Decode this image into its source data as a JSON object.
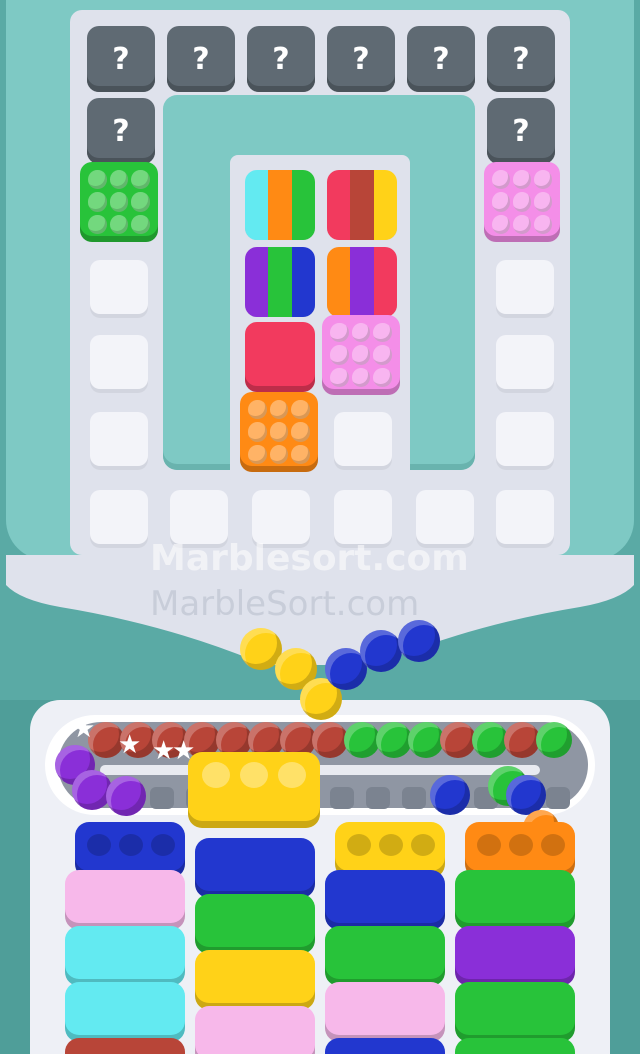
{
  "mystery_label": "?",
  "watermark_main": "Marblesort.com",
  "watermark_sub": "MarbleSort.com",
  "colors": {
    "red": "#b84538",
    "green": "#28c33a",
    "blue": "#2237cf",
    "yellow": "#ffd218",
    "purple": "#8a2fd8",
    "orange": "#ff8a14",
    "pink": "#f48ee8",
    "cyan": "#63eaf1",
    "crimson": "#f23a5e",
    "lightpink": "#f7b8ea",
    "mystery": "#5f6a73"
  },
  "board": {
    "mystery_tiles": 8,
    "tiles": [
      {
        "name": "green-dotted-tile",
        "pattern": "dots",
        "color": "green"
      },
      {
        "name": "pink-dotted-tile-right",
        "pattern": "dots",
        "color": "pink"
      },
      {
        "name": "striped-tile-cyan-orange-green",
        "pattern": "stripes",
        "stripes": [
          "#63eaf1",
          "#ff8a14",
          "#28c33a"
        ]
      },
      {
        "name": "striped-tile-red-brown-yellow",
        "pattern": "stripes",
        "stripes": [
          "#f23a5e",
          "#b84538",
          "#ffd218"
        ]
      },
      {
        "name": "striped-tile-purple-green-blue",
        "pattern": "stripes",
        "stripes": [
          "#8a2fd8",
          "#28c33a",
          "#2237cf"
        ]
      },
      {
        "name": "striped-tile-orange-purple-red",
        "pattern": "stripes",
        "stripes": [
          "#ff8a14",
          "#8a2fd8",
          "#f23a5e"
        ]
      },
      {
        "name": "crimson-plain-tile",
        "pattern": "plain",
        "color": "crimson"
      },
      {
        "name": "pink-dotted-tile-center",
        "pattern": "dots",
        "color": "pink"
      },
      {
        "name": "orange-dotted-tile",
        "pattern": "dots",
        "color": "orange"
      }
    ]
  },
  "conveyor": {
    "top_marbles": [
      "red",
      "red",
      "red",
      "red",
      "red",
      "red",
      "red",
      "red",
      "green",
      "green",
      "green",
      "red",
      "green",
      "red",
      "green"
    ],
    "left_marbles": [
      "purple",
      "purple",
      "purple"
    ],
    "right_marbles": [
      "blue",
      "green",
      "blue"
    ],
    "stars": 4
  },
  "falling_marbles": [
    "yellow",
    "yellow",
    "yellow",
    "blue",
    "blue",
    "blue"
  ],
  "active_cup": {
    "color": "yellow",
    "holes": 3
  },
  "cup_columns": [
    {
      "top": {
        "color": "blue",
        "holes": 3
      },
      "stack": [
        "lightpink",
        "cyan",
        "cyan",
        "red"
      ]
    },
    {
      "stack": [
        "blue",
        "green",
        "yellow",
        "lightpink"
      ]
    },
    {
      "top": {
        "color": "yellow",
        "holes": 3
      },
      "stack": [
        "blue",
        "green",
        "lightpink",
        "blue"
      ]
    },
    {
      "top": {
        "color": "orange",
        "holes": 3
      },
      "stack": [
        "green",
        "purple",
        "green",
        "green"
      ]
    }
  ]
}
